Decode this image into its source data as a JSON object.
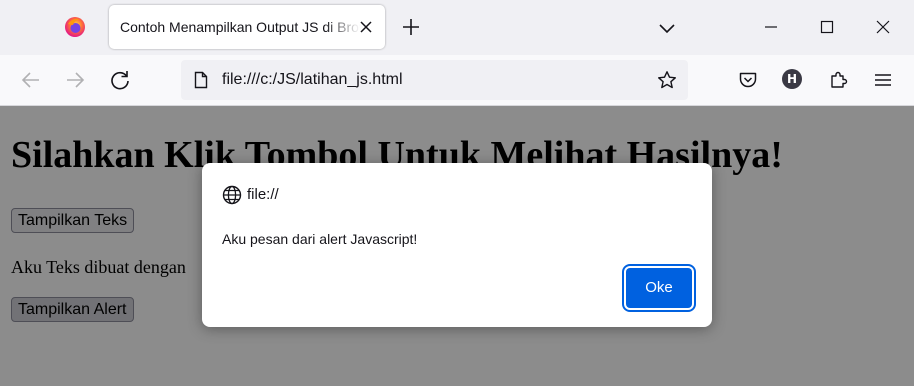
{
  "browser": {
    "tab": {
      "title": "Contoh Menampilkan Output JS di Browser"
    },
    "url": "file:///c:/JS/latihan_js.html",
    "account_initial": "H"
  },
  "page": {
    "heading": "Silahkan Klik Tombol Untuk Melihat Hasilnya!",
    "button_teks_label": "Tampilkan Teks",
    "paragraph": "Aku Teks dibuat dengan",
    "button_alert_label": "Tampilkan Alert"
  },
  "dialog": {
    "origin": "file://",
    "message": "Aku pesan dari alert Javascript!",
    "ok_label": "Oke"
  },
  "icons": {
    "browser_logo": "firefox-logo-icon",
    "tab_close": "close-icon",
    "new_tab": "plus-icon",
    "tab_list": "chevron-down-icon",
    "minimize": "minimize-icon",
    "maximize": "maximize-icon",
    "window_close": "close-icon",
    "back": "arrow-left-icon",
    "forward": "arrow-right-icon",
    "reload": "reload-icon",
    "page": "page-icon",
    "bookmark": "star-icon",
    "pocket": "pocket-icon",
    "account": "account-icon",
    "extensions": "puzzle-icon",
    "menu": "hamburger-icon",
    "dialog_origin": "globe-icon"
  },
  "colors": {
    "primary_button": "#0061e0",
    "tabstrip_bg": "#f0f0f4",
    "toolbar_bg": "#f9f9fb",
    "modal_overlay": "rgba(0,0,0,0.45)"
  }
}
